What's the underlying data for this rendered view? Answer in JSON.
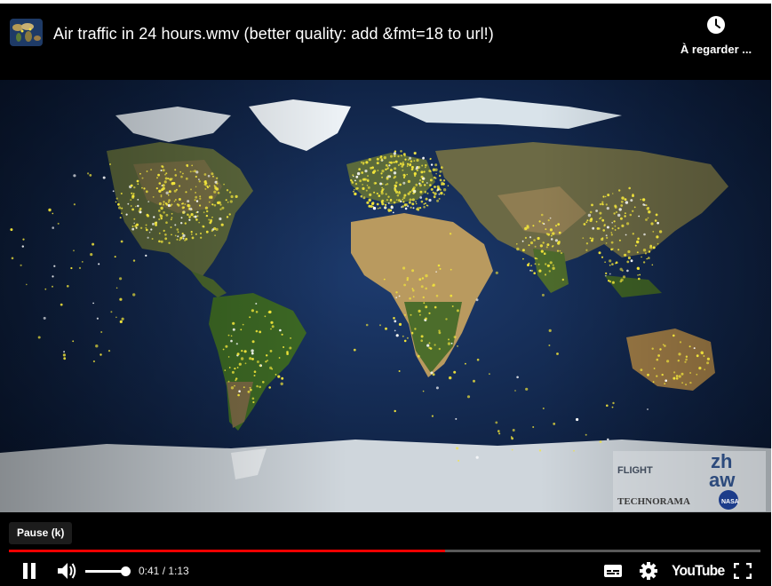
{
  "header": {
    "title": "Air traffic in 24 hours.wmv (better quality: add &fmt=18 to url!)",
    "watch_later_label": "À regarder ...",
    "watch_later_icon": "clock-icon"
  },
  "video": {
    "overlay_logos": {
      "flight": "FLIGHT",
      "zh": "zh",
      "aw": "aw",
      "technorama": "TECHNORAMA",
      "nasa": "NASA"
    }
  },
  "tooltip": {
    "pause": "Pause (k)"
  },
  "progress": {
    "played_fraction": 0.58,
    "color": "#ee0000"
  },
  "controls": {
    "time": "0:41 / 1:13",
    "volume_fraction": 0.9,
    "brand": "YouTube",
    "icons": [
      "pause-icon",
      "volume-icon",
      "subtitles-icon",
      "gear-icon",
      "fullscreen-icon"
    ]
  }
}
